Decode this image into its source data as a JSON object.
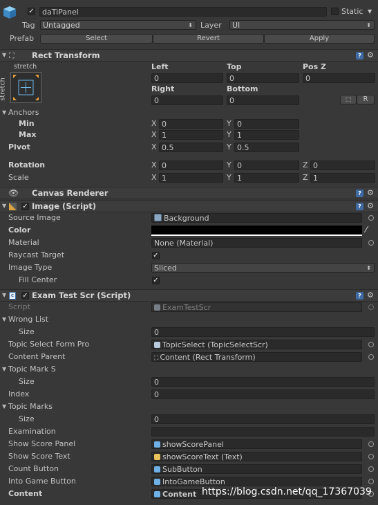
{
  "gameobject": {
    "name": "daTiPanel",
    "static_label": "Static",
    "tag_label": "Tag",
    "tag_value": "Untagged",
    "layer_label": "Layer",
    "layer_value": "UI",
    "prefab_label": "Prefab",
    "prefab_select": "Select",
    "prefab_revert": "Revert",
    "prefab_apply": "Apply"
  },
  "rect_transform": {
    "title": "Rect Transform",
    "anchor_preset": "stretch",
    "anchor_preset_side": "stretch",
    "left_label": "Left",
    "left_value": "0",
    "top_label": "Top",
    "top_value": "0",
    "posz_label": "Pos Z",
    "posz_value": "0",
    "right_label": "Right",
    "right_value": "0",
    "bottom_label": "Bottom",
    "bottom_value": "0",
    "r_button": "R",
    "anchors_label": "Anchors",
    "min_label": "Min",
    "min_x": "0",
    "min_y": "0",
    "max_label": "Max",
    "max_x": "1",
    "max_y": "1",
    "pivot_label": "Pivot",
    "pivot_x": "0.5",
    "pivot_y": "0.5",
    "rotation_label": "Rotation",
    "rot_x": "0",
    "rot_y": "0",
    "rot_z": "0",
    "scale_label": "Scale",
    "scale_x": "1",
    "scale_y": "1",
    "scale_z": "1",
    "x": "X",
    "y": "Y",
    "z": "Z"
  },
  "canvas_renderer": {
    "title": "Canvas Renderer"
  },
  "image": {
    "title": "Image (Script)",
    "source_image_label": "Source Image",
    "source_image_value": "Background",
    "color_label": "Color",
    "color_value": "#000000",
    "material_label": "Material",
    "material_value": "None (Material)",
    "raycast_label": "Raycast Target",
    "image_type_label": "Image Type",
    "image_type_value": "Sliced",
    "fill_center_label": "Fill Center"
  },
  "exam": {
    "title": "Exam Test Scr (Script)",
    "script_label": "Script",
    "script_value": "ExamTestScr",
    "wrong_list_label": "Wrong List",
    "size_label": "Size",
    "wrong_list_size": "0",
    "topic_select_label": "Topic Select Form Pro",
    "topic_select_value": "TopicSelect (TopicSelectScr)",
    "content_parent_label": "Content Parent",
    "content_parent_value": "Content (Rect Transform)",
    "topic_mark_s_label": "Topic Mark S",
    "topic_mark_s_size": "0",
    "index_label": "Index",
    "index_value": "0",
    "topic_marks_label": "Topic Marks",
    "topic_marks_size": "0",
    "examination_label": "Examination",
    "examination_value": "",
    "show_score_panel_label": "Show Score Panel",
    "show_score_panel_value": "showScorePanel",
    "show_score_text_label": "Show Score Text",
    "show_score_text_value": "showScoreText (Text)",
    "count_button_label": "Count Button",
    "count_button_value": "SubButton",
    "into_game_label": "Into Game Button",
    "into_game_value": "IntoGameButton",
    "content_label": "Content",
    "content_value": "Content"
  },
  "watermark": "https://blog.csdn.net/qq_17367039"
}
